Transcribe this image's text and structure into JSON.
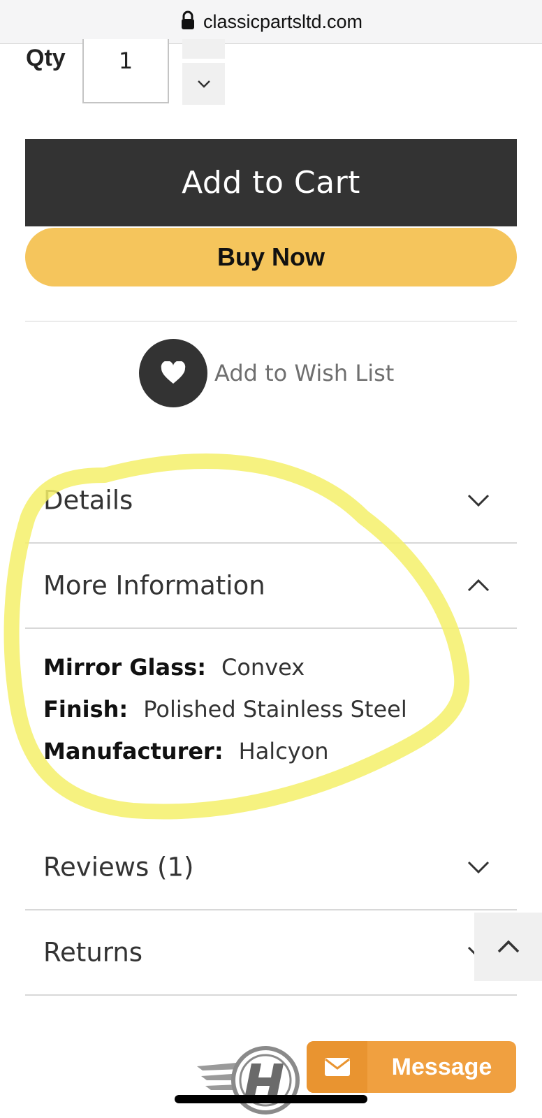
{
  "browser": {
    "url": "classicpartsltd.com"
  },
  "qty": {
    "label": "Qty",
    "value": "1"
  },
  "actions": {
    "add_to_cart": "Add to Cart",
    "buy_now": "Buy Now",
    "wish_list": "Add to Wish List"
  },
  "accordion": [
    {
      "title": "Details",
      "expanded": false
    },
    {
      "title": "More Information",
      "expanded": true
    },
    {
      "title": "Reviews (1)",
      "expanded": false
    },
    {
      "title": "Returns",
      "expanded": false
    }
  ],
  "more_information": [
    {
      "key": "Mirror Glass:",
      "value": "Convex"
    },
    {
      "key": "Finish:",
      "value": "Polished Stainless Steel"
    },
    {
      "key": "Manufacturer:",
      "value": "Halcyon"
    }
  ],
  "chat": {
    "label": "Message"
  },
  "colors": {
    "cart_button": "#333333",
    "buy_button": "#f5c55c",
    "message_button": "#f0a040",
    "highlight": "#f5f06a"
  },
  "icons": [
    "lock-icon",
    "chevron-down-icon",
    "heart-icon",
    "chevron-up-icon",
    "envelope-icon",
    "halcyon-logo"
  ]
}
